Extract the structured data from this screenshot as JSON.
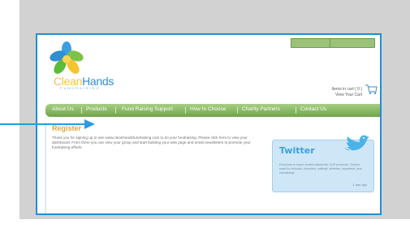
{
  "header_buttons": [
    "",
    ""
  ],
  "logo": {
    "brand_clean": "Clean",
    "brand_hands": "Hands",
    "tagline": "FUNDRAISING"
  },
  "cart": {
    "line1": "Items in cart ( 0 )",
    "line2": "View Your Cart"
  },
  "nav": {
    "items": [
      "About Us",
      "Products",
      "Fund Raising Support",
      "How to Choose",
      "Charity Partners",
      "Contact Us"
    ]
  },
  "register": {
    "title": "Register",
    "body": "Thank you for signing up to use www.cleanhandsfundraising.com to do your fundraising. Please click here to view your dashboard. From there you can view your group and start building your web page and email newsletters to promote your fundraising efforts."
  },
  "twitter": {
    "title": "Twitter",
    "body": "Everyone is super excited about the CHF products. They're used for schools, churches, softball, athletes, anywhere, and everything!",
    "link": "1 day ago"
  },
  "colors": {
    "frame": "#1f8fd8",
    "nav": "#7fb257",
    "accent": "#e0a53a",
    "twitter_bg": "#cfe6f6"
  }
}
